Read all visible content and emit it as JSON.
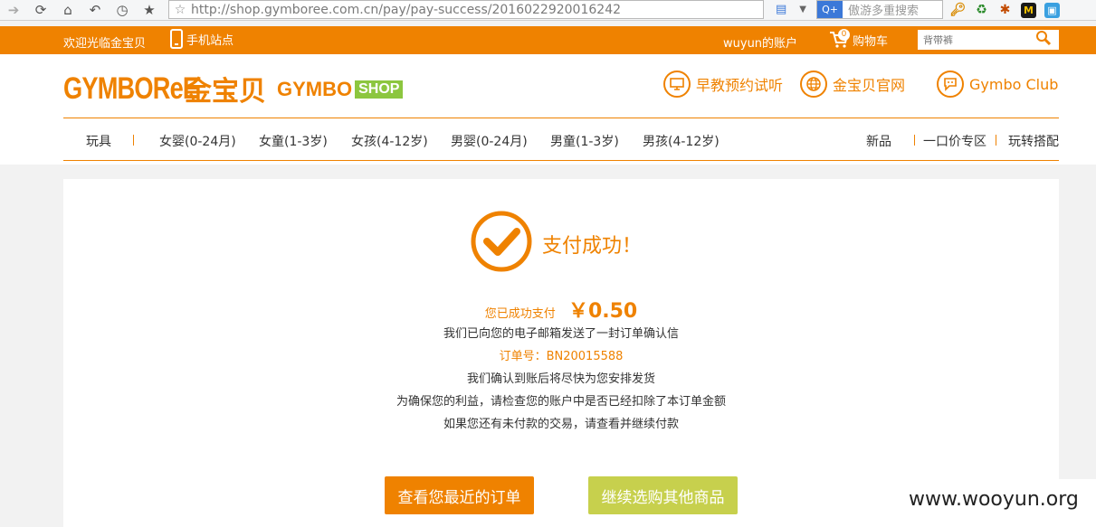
{
  "browser": {
    "url": "http://shop.gymboree.com.cn/pay/pay-success/2016022920016242",
    "search_engine_placeholder": "傲游多重搜索"
  },
  "topbar": {
    "welcome": "欢迎光临金宝贝",
    "mobile_site": "手机站点",
    "account": "wuyun的账户",
    "cart_count": "0",
    "cart_label": "购物车",
    "search_placeholder": "背带裤"
  },
  "header": {
    "logo_en": "GYMBOReE",
    "logo_cn": "金宝贝",
    "shop_logo_a": "GYMBO",
    "shop_logo_b": "SHOP",
    "links": [
      {
        "label": "早教预约试听"
      },
      {
        "label": "金宝贝官网"
      },
      {
        "label": "Gymbo Club"
      }
    ]
  },
  "nav": {
    "items": [
      "玩具",
      "女婴(0-24月)",
      "女童(1-3岁)",
      "女孩(4-12岁)",
      "男婴(0-24月)",
      "男童(1-3岁)",
      "男孩(4-12岁)",
      "新品",
      "一口价专区",
      "玩转搭配"
    ]
  },
  "result": {
    "title": "支付成功！",
    "paid_label": "您已成功支付",
    "amount": "￥0.50",
    "email_note": "我们已向您的电子邮箱发送了一封订单确认信",
    "order_no": "订单号：BN20015588",
    "ship_note": "我们确认到账后将尽快为您安排发货",
    "check_note": "为确保您的利益，请检查您的账户中是否已经扣除了本订单金额",
    "unpaid_note": "如果您还有未付款的交易，请查看并继续付款",
    "btn_orders": "查看您最近的订单",
    "btn_shop": "继续选购其他商品"
  },
  "watermark": "www.wooyun.org",
  "colors": {
    "accent": "#ef8200",
    "green": "#c7d04d"
  }
}
